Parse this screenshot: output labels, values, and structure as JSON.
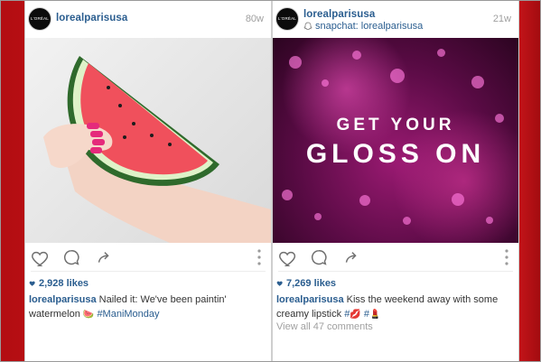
{
  "posts": [
    {
      "username": "lorealparisusa",
      "avatar_text": "L'ORÉAL",
      "age": "80w",
      "likes": "2,928 likes",
      "caption": {
        "user": "lorealparisusa",
        "text1": "Nailed it: We've been paintin' watermelon",
        "emoji1": "🍉",
        "hashtag1": "#ManiMonday"
      }
    },
    {
      "username": "lorealparisusa",
      "avatar_text": "L'ORÉAL",
      "age": "21w",
      "subtitle": "snapchat: lorealparisusa",
      "image_text": {
        "line1": "GET YOUR",
        "line2": "GLOSS ON"
      },
      "likes": "7,269 likes",
      "caption": {
        "user": "lorealparisusa",
        "text1": "Kiss the weekend away with some creamy lipstick",
        "hashtag1": "#",
        "emoji1": "💋",
        "hashtag2": "#",
        "emoji2": "💄"
      },
      "comments_link": "View all 47 comments"
    }
  ],
  "colors": {
    "link": "#2a5d8f",
    "muted": "#a0a0a0",
    "frame": "#d7181d"
  },
  "icons": [
    "heart-icon",
    "comment-icon",
    "share-icon",
    "more-icon",
    "snapchat-ghost-icon",
    "likes-heart-icon"
  ]
}
